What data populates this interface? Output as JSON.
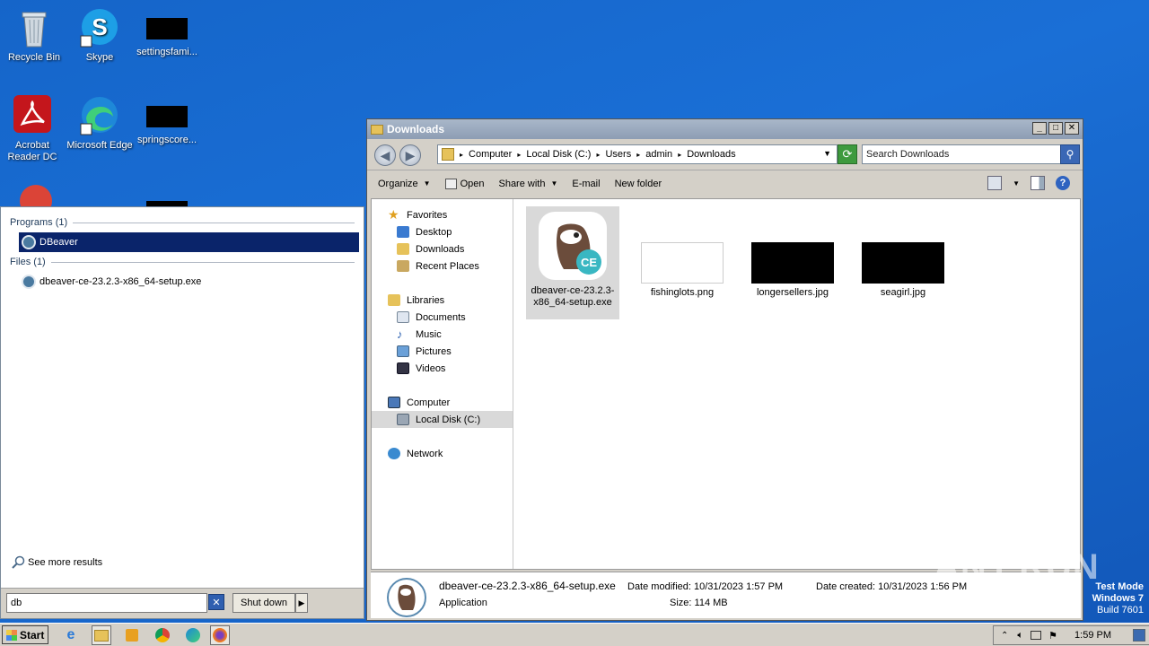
{
  "desktop": {
    "icons": [
      {
        "label": "Recycle Bin"
      },
      {
        "label": "Skype"
      },
      {
        "label": "settingsfami..."
      },
      {
        "label": "Acrobat Reader DC"
      },
      {
        "label": "Microsoft Edge"
      },
      {
        "label": "springscore..."
      }
    ]
  },
  "start_menu": {
    "programs_header": "Programs (1)",
    "programs": [
      {
        "label": "DBeaver"
      }
    ],
    "files_header": "Files (1)",
    "files": [
      {
        "label": "dbeaver-ce-23.2.3-x86_64-setup.exe"
      }
    ],
    "see_more": "See more results",
    "search_value": "db",
    "shutdown_label": "Shut down"
  },
  "explorer": {
    "title": "Downloads",
    "breadcrumb": [
      "Computer",
      "Local Disk (C:)",
      "Users",
      "admin",
      "Downloads"
    ],
    "search_placeholder": "Search Downloads",
    "toolbar": {
      "organize": "Organize",
      "open": "Open",
      "share_with": "Share with",
      "email": "E-mail",
      "new_folder": "New folder"
    },
    "nav": {
      "favorites": "Favorites",
      "favorites_items": [
        "Desktop",
        "Downloads",
        "Recent Places"
      ],
      "libraries": "Libraries",
      "libraries_items": [
        "Documents",
        "Music",
        "Pictures",
        "Videos"
      ],
      "computer": "Computer",
      "computer_items": [
        "Local Disk (C:)"
      ],
      "network": "Network"
    },
    "files": [
      {
        "name": "dbeaver-ce-23.2.3-x86_64-setup.exe",
        "line1": "dbeaver-ce-23.2.3-",
        "line2": "x86_64-setup.exe",
        "badge": "CE"
      },
      {
        "name": "fishinglots.png"
      },
      {
        "name": "longersellers.jpg"
      },
      {
        "name": "seagirl.jpg"
      }
    ],
    "details": {
      "name": "dbeaver-ce-23.2.3-x86_64-setup.exe",
      "type": "Application",
      "modified_label": "Date modified:",
      "modified_value": "10/31/2023 1:57 PM",
      "size_label": "Size:",
      "size_value": "114 MB",
      "created_label": "Date created:",
      "created_value": "10/31/2023 1:56 PM"
    }
  },
  "taskbar": {
    "start_label": "Start",
    "clock": "1:59 PM"
  },
  "watermark": {
    "line1": "Test Mode",
    "line2": "Windows 7",
    "line3": "Build 7601",
    "brand": "ANY.RUN"
  },
  "colors": {
    "desktop": "#1565c9",
    "selection": "#0a246a",
    "window_chrome": "#d4d0c8"
  }
}
